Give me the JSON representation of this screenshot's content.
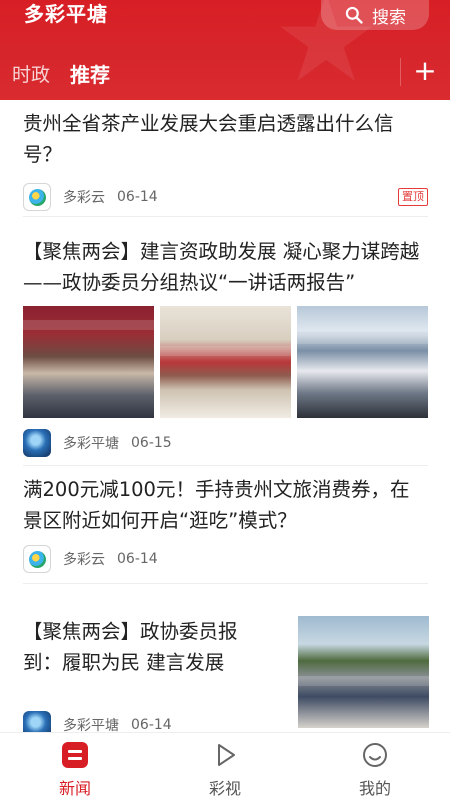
{
  "header": {
    "app_title": "多彩平塘",
    "search_label": "搜索",
    "tabs": [
      {
        "label": "时政",
        "active": false
      },
      {
        "label": "推荐",
        "active": true
      }
    ],
    "add_label": "+"
  },
  "colors": {
    "brand": "#d81e25",
    "pin_badge": "#e53b3b"
  },
  "feed": {
    "items": [
      {
        "title": "贵州全省茶产业发展大会重启透露出什么信号？",
        "source": "多彩云",
        "date": "06-14",
        "badge": "置顶",
        "avatar": "duocaiyun-logo-icon"
      },
      {
        "title": "【聚焦两会】建言资政助发展 凝心聚力谋跨越——政协委员分组热议“一讲话两报告”",
        "source": "多彩平塘",
        "date": "06-15",
        "avatar": "globe-logo-icon",
        "images": 3
      },
      {
        "title": "满200元减100元！手持贵州文旅消费券，在景区附近如何开启“逛吃”模式？",
        "source": "多彩云",
        "date": "06-14",
        "avatar": "duocaiyun-logo-icon"
      },
      {
        "title": "【聚焦两会】政协委员报到：履职为民 建言发展",
        "source": "多彩平塘",
        "date": "06-14",
        "avatar": "globe-logo-icon",
        "images": 1
      }
    ]
  },
  "bottom_nav": [
    {
      "label": "新闻",
      "icon": "news-icon",
      "active": true
    },
    {
      "label": "彩视",
      "icon": "play-icon",
      "active": false
    },
    {
      "label": "我的",
      "icon": "smiley-icon",
      "active": false
    }
  ]
}
